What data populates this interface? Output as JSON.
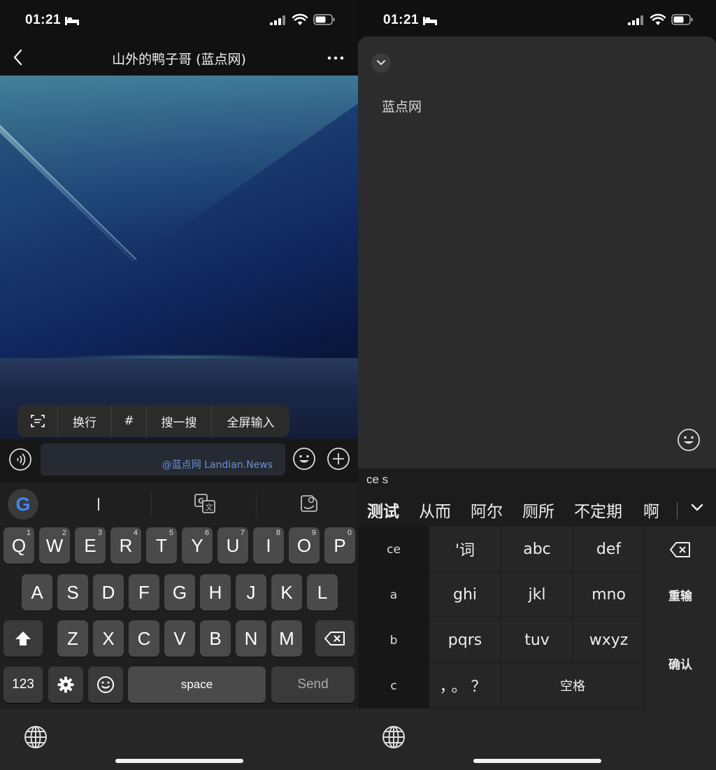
{
  "left": {
    "status": {
      "time": "01:21"
    },
    "chat": {
      "title": "山外的鸭子哥 (蓝点网)"
    },
    "popup_menu": {
      "items": [
        "换行",
        "#",
        "搜一搜",
        "全屏输入"
      ]
    },
    "input": {
      "watermark": "@蓝点网 Landian.News"
    },
    "keyboard": {
      "google_logo": "G",
      "row1": [
        {
          "l": "Q",
          "n": "1"
        },
        {
          "l": "W",
          "n": "2"
        },
        {
          "l": "E",
          "n": "3"
        },
        {
          "l": "R",
          "n": "4"
        },
        {
          "l": "T",
          "n": "5"
        },
        {
          "l": "Y",
          "n": "6"
        },
        {
          "l": "U",
          "n": "7"
        },
        {
          "l": "I",
          "n": "8"
        },
        {
          "l": "O",
          "n": "9"
        },
        {
          "l": "P",
          "n": "0"
        }
      ],
      "row2": [
        "A",
        "S",
        "D",
        "F",
        "G",
        "H",
        "J",
        "K",
        "L"
      ],
      "row3": [
        "Z",
        "X",
        "C",
        "V",
        "B",
        "N",
        "M"
      ],
      "num_key": "123",
      "space": "space",
      "send": "Send"
    }
  },
  "right": {
    "status": {
      "time": "01:21"
    },
    "input_text": "蓝点网",
    "ime": {
      "pinyin": "ce s",
      "candidates": [
        "测试",
        "从而",
        "阿尔",
        "厕所",
        "不定期",
        "啊"
      ],
      "side": [
        "ce",
        "a",
        "b",
        "c"
      ],
      "grid": [
        "'词",
        "abc",
        "def",
        "ghi",
        "jkl",
        "mno",
        "pqrs",
        "tuv",
        "wxyz"
      ],
      "punct": "，。？",
      "space": "空格",
      "retype": "重输",
      "confirm": "确认"
    }
  },
  "colors": {
    "keyboard_bg": "#1f1f1f",
    "key": "#4a4a4a",
    "watermark": "#6a8fd6"
  }
}
